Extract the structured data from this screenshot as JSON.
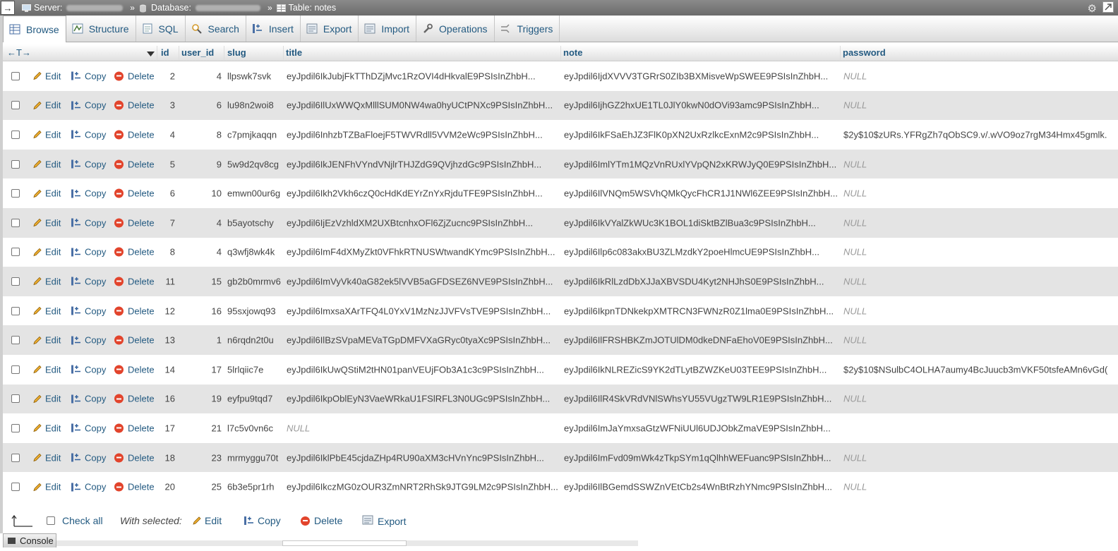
{
  "topbar": {
    "back_glyph": "→",
    "server_label": "Server:",
    "database_label": "Database:",
    "table_label": "Table: notes",
    "separator": "»"
  },
  "tabs": [
    {
      "label": "Browse",
      "icon": "browse-icon",
      "active": true
    },
    {
      "label": "Structure",
      "icon": "structure-icon"
    },
    {
      "label": "SQL",
      "icon": "sql-icon"
    },
    {
      "label": "Search",
      "icon": "search-icon"
    },
    {
      "label": "Insert",
      "icon": "insert-icon"
    },
    {
      "label": "Export",
      "icon": "export-icon"
    },
    {
      "label": "Import",
      "icon": "import-icon"
    },
    {
      "label": "Operations",
      "icon": "operations-icon"
    },
    {
      "label": "Triggers",
      "icon": "triggers-icon"
    }
  ],
  "grid": {
    "header": {
      "arrows": "←T→",
      "columns": [
        "id",
        "user_id",
        "slug",
        "title",
        "note",
        "password"
      ]
    },
    "actions": {
      "edit": "Edit",
      "copy": "Copy",
      "delete": "Delete"
    },
    "rows": [
      {
        "id": "2",
        "user_id": "4",
        "slug": "llpswk7svk",
        "title": "eyJpdil6IkJubjFkTThDZjMvc1RzOVI4dHkvalE9PSIsInZhbH...",
        "note": "eyJpdil6IjdXVVV3TGRrS0ZIb3BXMisveWpSWEE9PSIsInZhbH...",
        "password": "NULL"
      },
      {
        "id": "3",
        "user_id": "6",
        "slug": "lu98n2woi8",
        "title": "eyJpdil6IlUxWWQxMlllSUM0NW4wa0hyUCtPNXc9PSIsInZhbH...",
        "note": "eyJpdil6IjhGZ2hxUE1TL0JlY0kwN0dOVi93amc9PSIsInZhbH...",
        "password": "NULL"
      },
      {
        "id": "4",
        "user_id": "8",
        "slug": "c7pmjkaqqn",
        "title": "eyJpdil6InhzbTZBaFloejF5TWVRdll5VVM2eWc9PSIsInZhbH...",
        "note": "eyJpdil6IkFSaEhJZ3FlK0pXN2UxRzlkcExnM2c9PSIsInZhbH...",
        "password": "$2y$10$zURs.YFRgZh7qObSC9.v/.wVO9oz7rgM34Hmx45gmlk."
      },
      {
        "id": "5",
        "user_id": "9",
        "slug": "5w9d2qv8cg",
        "title": "eyJpdil6IkJENFhVYndVNjlrTHJZdG9QVjhzdGc9PSIsInZhbH...",
        "note": "eyJpdil6ImlYTm1MQzVnRUxlYVpQN2xKRWJyQ0E9PSIsInZhbH...",
        "password": "NULL"
      },
      {
        "id": "6",
        "user_id": "10",
        "slug": "emwn00ur6g",
        "title": "eyJpdil6Ikh2Vkh6czQ0cHdKdEYrZnYxRjduTFE9PSIsInZhbH...",
        "note": "eyJpdil6IlVNQm5WSVhQMkQycFhCR1J1NWl6ZEE9PSIsInZhbH...",
        "password": "NULL"
      },
      {
        "id": "7",
        "user_id": "4",
        "slug": "b5ayotschy",
        "title": "eyJpdil6IjEzVzhldXM2UXBtcnhxOFl6ZjZucnc9PSIsInZhbH...",
        "note": "eyJpdil6IkVYalZkWUc3K1BOL1diSktBZlBua3c9PSIsInZhbH...",
        "password": "NULL"
      },
      {
        "id": "8",
        "user_id": "4",
        "slug": "q3wfj8wk4k",
        "title": "eyJpdil6ImF4dXMyZkt0VFhkRTNUSWtwandKYmc9PSIsInZhbH...",
        "note": "eyJpdil6Ilp6c083akxBU3ZLMzdkY2poeHlmcUE9PSIsInZhbH...",
        "password": "NULL"
      },
      {
        "id": "11",
        "user_id": "15",
        "slug": "gb2b0mrmv6",
        "title": "eyJpdil6ImVyVk40aG82ek5lVVB5aGFDSEZ6NVE9PSIsInZhbH...",
        "note": "eyJpdil6IkRlLzdDbXJJaXBVSDU4Kyt2NHJhS0E9PSIsInZhbH...",
        "password": "NULL"
      },
      {
        "id": "12",
        "user_id": "16",
        "slug": "95sxjowq93",
        "title": "eyJpdil6ImxsaXArTFQ4L0YxV1MzNzJJVFVsTVE9PSIsInZhbH...",
        "note": "eyJpdil6IkpnTDNkekpXMTRCN3FWNzR0Z1lma0E9PSIsInZhbH...",
        "password": "NULL"
      },
      {
        "id": "13",
        "user_id": "1",
        "slug": "n6rqdn2t0u",
        "title": "eyJpdil6IlBzSVpaMEVaTGpDMFVXaGRyc0tyaXc9PSIsInZhbH...",
        "note": "eyJpdil6IlFRSHBKZmJOTUlDM0dkeDNFaEhoV0E9PSIsInZhbH...",
        "password": "NULL"
      },
      {
        "id": "14",
        "user_id": "17",
        "slug": "5lrlqiic7e",
        "title": "eyJpdil6IkUwQStiM2tHN01panVEUjFOb3A1c3c9PSIsInZhbH...",
        "note": "eyJpdil6IkNLREZicS9YK2dTLytBZWZKeU03TEE9PSIsInZhbH...",
        "password": "$2y$10$NSulbC4OLHA7aumy4BcJuucb3mVKF50tsfeAMn6vGd("
      },
      {
        "id": "16",
        "user_id": "19",
        "slug": "eyfpu9tqd7",
        "title": "eyJpdil6IkpOblEyN3VaeWRkaU1FSlRFL3N0UGc9PSIsInZhbH...",
        "note": "eyJpdil6IlR4SkVRdVNlSWhsYU55VUgzTW9LR1E9PSIsInZhbH...",
        "password": "NULL"
      },
      {
        "id": "17",
        "user_id": "21",
        "slug": "l7c5v0vn6c",
        "title": "NULL",
        "note": "eyJpdil6ImJaYmxsaGtzWFNiUUl6UDJObkZmaVE9PSIsInZhbH...",
        "password": ""
      },
      {
        "id": "18",
        "user_id": "23",
        "slug": "mrmyggu70t",
        "title": "eyJpdil6IklPbE45cjdaZHp4RU90aXM3cHVnYnc9PSIsInZhbH...",
        "note": "eyJpdil6ImFvd09mWk4zTkpSYm1qQlhhWEFuanc9PSIsInZhbH...",
        "password": "NULL"
      },
      {
        "id": "20",
        "user_id": "25",
        "slug": "6b3e5pr1rh",
        "title": "eyJpdil6IkczMG0zOUR3ZmNRT2RhSk9JTG9LM2c9PSIsInZhbH...",
        "note": "eyJpdil6IlBGemdSSWZnVEtCb2s4WnBtRzhYNmc9PSIsInZhbH...",
        "password": "NULL"
      }
    ]
  },
  "footer": {
    "check_all": "Check all",
    "with_selected": "With selected:",
    "edit": "Edit",
    "copy": "Copy",
    "delete": "Delete",
    "export": "Export"
  },
  "console": {
    "label": "Console"
  },
  "colors": {
    "link": "#235a81",
    "row_even": "#e4e4e4",
    "null_text": "#999999",
    "delete_red": "#e2442c",
    "topbar": "#7a7a7a"
  }
}
